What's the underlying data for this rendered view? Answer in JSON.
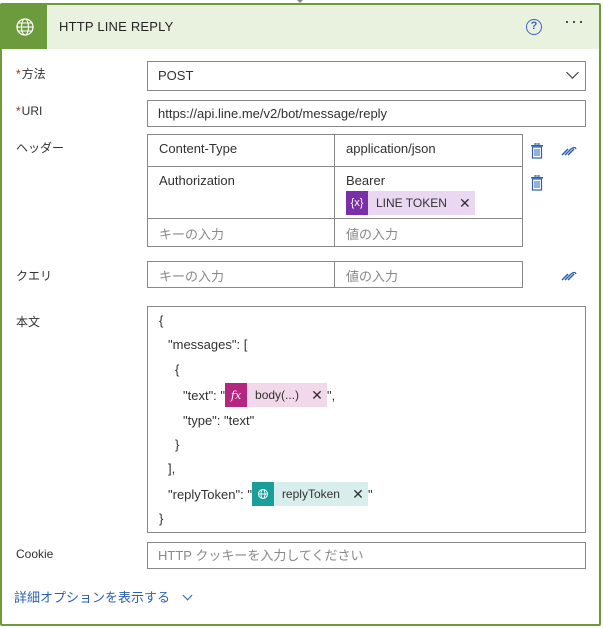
{
  "action": {
    "title": "HTTP LINE REPLY",
    "header_color": "#6b9b3d"
  },
  "method": {
    "label": "方法",
    "value": "POST"
  },
  "uri": {
    "label": "URI",
    "value": "https://api.line.me/v2/bot/message/reply"
  },
  "headers": {
    "label": "ヘッダー",
    "rows": [
      {
        "key": "Content-Type",
        "value": "application/json"
      },
      {
        "key": "Authorization",
        "value": "Bearer",
        "token": {
          "icon": "{x}",
          "label": "LINE TOKEN"
        }
      }
    ],
    "key_placeholder": "キーの入力",
    "value_placeholder": "値の入力"
  },
  "query": {
    "label": "クエリ",
    "key_placeholder": "キーの入力",
    "value_placeholder": "値の入力"
  },
  "body": {
    "label": "本文",
    "lines": {
      "l1": "{",
      "l2": "\"messages\": [",
      "l3": "{",
      "l4_pre": "\"text\": \"",
      "l4_post": "\",",
      "l5": "\"type\": \"text\"",
      "l6": "}",
      "l7": "],",
      "l8_pre": "\"replyToken\": \"",
      "l8_post": "\"",
      "l9": "}"
    },
    "text_token": {
      "icon": "fx",
      "label": "body(...)"
    },
    "reply_token": {
      "label": "replyToken"
    }
  },
  "cookie": {
    "label": "Cookie",
    "placeholder": "HTTP クッキーを入力してください"
  },
  "advanced_link": "詳細オプションを表示する"
}
